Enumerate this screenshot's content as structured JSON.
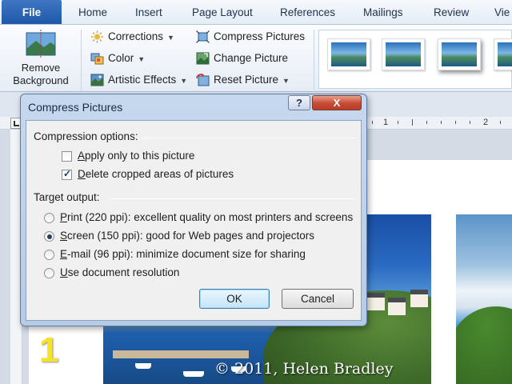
{
  "ribbon": {
    "file_tab": "File",
    "tabs": [
      "Home",
      "Insert",
      "Page Layout",
      "References",
      "Mailings",
      "Review",
      "Vie"
    ],
    "remove_background": {
      "line1": "Remove",
      "line2": "Background"
    },
    "adjust": {
      "corrections": "Corrections",
      "color": "Color",
      "artistic_effects": "Artistic Effects",
      "compress_pictures": "Compress Pictures",
      "change_picture": "Change Picture",
      "reset_picture": "Reset Picture"
    }
  },
  "ruler": {
    "left_mark": "1",
    "right_mark": "2"
  },
  "document": {
    "page_number": "1",
    "copyright": "© 2011, Helen Bradley"
  },
  "dialog": {
    "title": "Compress Pictures",
    "help": "?",
    "close": "X",
    "compression_options": {
      "label": "Compression options:",
      "apply_only": {
        "key": "A",
        "rest": "pply only to this picture",
        "checked": false
      },
      "delete_cropped": {
        "key": "D",
        "rest": "elete cropped areas of pictures",
        "checked": true
      }
    },
    "target_output": {
      "label": "Target output:",
      "options": [
        {
          "key": "P",
          "rest": "rint (220 ppi): excellent quality on most printers and screens",
          "selected": false
        },
        {
          "key": "S",
          "rest": "creen (150 ppi): good for Web pages and projectors",
          "selected": true
        },
        {
          "key": "E",
          "rest": "-mail (96 ppi): minimize document size for sharing",
          "selected": false
        },
        {
          "key": "U",
          "rest": "se document resolution",
          "selected": false
        }
      ]
    },
    "ok": "OK",
    "cancel": "Cancel"
  }
}
